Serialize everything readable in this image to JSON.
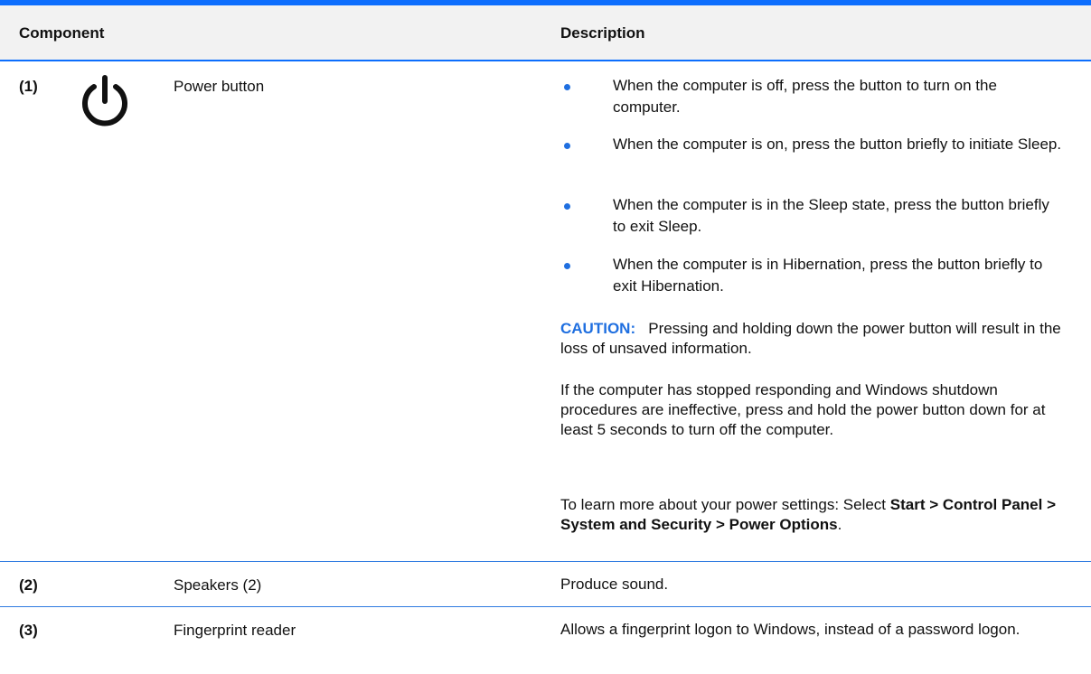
{
  "header": {
    "component_label": "Component",
    "description_label": "Description"
  },
  "rows": [
    {
      "number": "(1)",
      "icon": "power-icon",
      "name": "Power button",
      "bullets": [
        "When the computer is off, press the button to turn on the computer.",
        "When the computer is on, press the button briefly to initiate Sleep.",
        "When the computer is in the Sleep state, press the button briefly to exit Sleep.",
        "When the computer is in Hibernation, press the button briefly to exit Hibernation."
      ],
      "caution_label": "CAUTION:",
      "caution_text": "Pressing and holding down the power button will result in the loss of unsaved information.",
      "paragraph": "If the computer has stopped responding and Windows shutdown procedures are ineffective, press and hold the power button down for at least 5 seconds to turn off the computer.",
      "learn_more_prefix": "To learn more about your power settings: Select ",
      "learn_more_path": "Start > Control Panel > System and Security > Power Options",
      "learn_more_suffix": "."
    },
    {
      "number": "(2)",
      "name": "Speakers (2)",
      "description": "Produce sound."
    },
    {
      "number": "(3)",
      "name": "Fingerprint reader",
      "description": "Allows a fingerprint logon to Windows, instead of a password logon."
    }
  ],
  "colors": {
    "accent": "#1f6fe0",
    "header_bg": "#f2f2f2"
  }
}
